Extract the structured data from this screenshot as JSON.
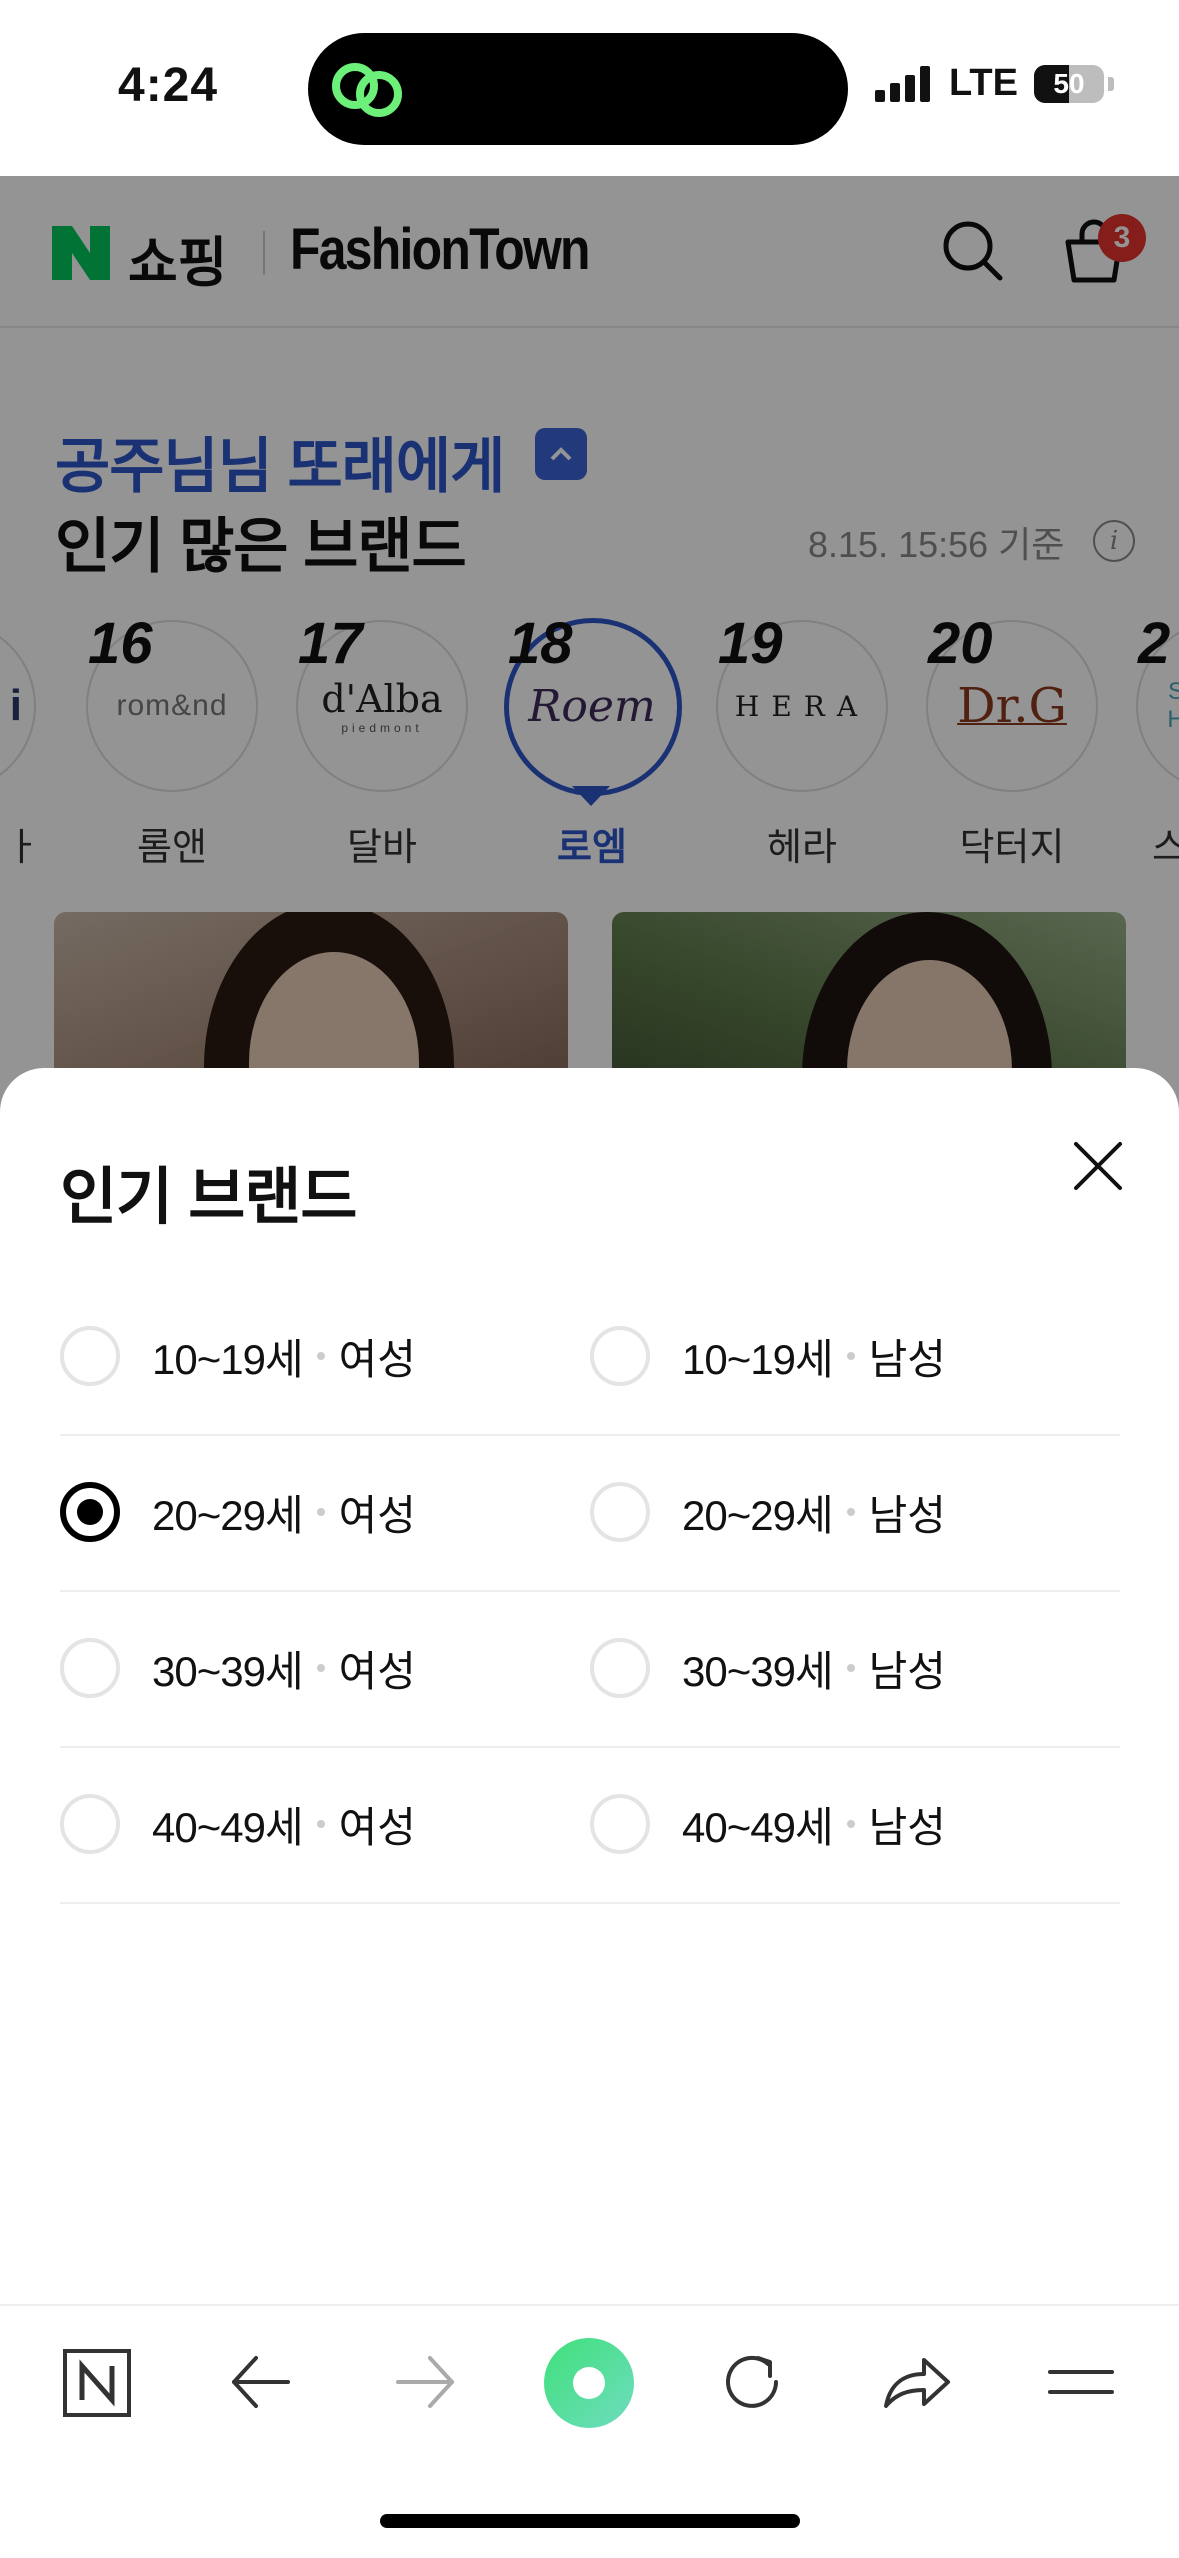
{
  "status_bar": {
    "time": "4:24",
    "network": "LTE",
    "battery": "50"
  },
  "header": {
    "shop_label": "쇼핑",
    "brand_label": "FashionTown",
    "cart_count": "3"
  },
  "section": {
    "greeting": "공주님님 또래에게",
    "title": "인기 많은 브랜드",
    "timestamp": "8.15. 15:56 기준",
    "info_glyph": "i"
  },
  "brands": [
    {
      "rank": "16",
      "logo": "rom&nd",
      "name": "롬앤"
    },
    {
      "rank": "17",
      "logo": "d'Alba",
      "logo_sub": "piedmont",
      "name": "달바"
    },
    {
      "rank": "18",
      "logo": "Roem",
      "name": "로엠",
      "selected": true
    },
    {
      "rank": "19",
      "logo": "HERA",
      "name": "헤라"
    },
    {
      "rank": "20",
      "logo": "Dr.G",
      "name": "닥터지"
    }
  ],
  "brands_partial": {
    "left_logo": "i",
    "left_name": "ㅏ",
    "right_rank": "2",
    "right_logo": "S H",
    "right_name": "스"
  },
  "sheet": {
    "title": "인기 브랜드",
    "options": [
      {
        "left": {
          "age": "10~19세",
          "gender": "여성",
          "selected": false
        },
        "right": {
          "age": "10~19세",
          "gender": "남성",
          "selected": false
        }
      },
      {
        "left": {
          "age": "20~29세",
          "gender": "여성",
          "selected": true
        },
        "right": {
          "age": "20~29세",
          "gender": "남성",
          "selected": false
        }
      },
      {
        "left": {
          "age": "30~39세",
          "gender": "여성",
          "selected": false
        },
        "right": {
          "age": "30~39세",
          "gender": "남성",
          "selected": false
        }
      },
      {
        "left": {
          "age": "40~49세",
          "gender": "여성",
          "selected": false
        },
        "right": {
          "age": "40~49세",
          "gender": "남성",
          "selected": false
        }
      }
    ]
  },
  "toolbar": {
    "items": [
      "naver-home-icon",
      "back-arrow-icon",
      "forward-arrow-icon",
      "green-dot-icon",
      "reload-icon",
      "share-icon",
      "menu-icon"
    ]
  },
  "colors": {
    "accent": "#2e57c9",
    "naver_green": "#03c75a",
    "badge": "#e5322d"
  }
}
